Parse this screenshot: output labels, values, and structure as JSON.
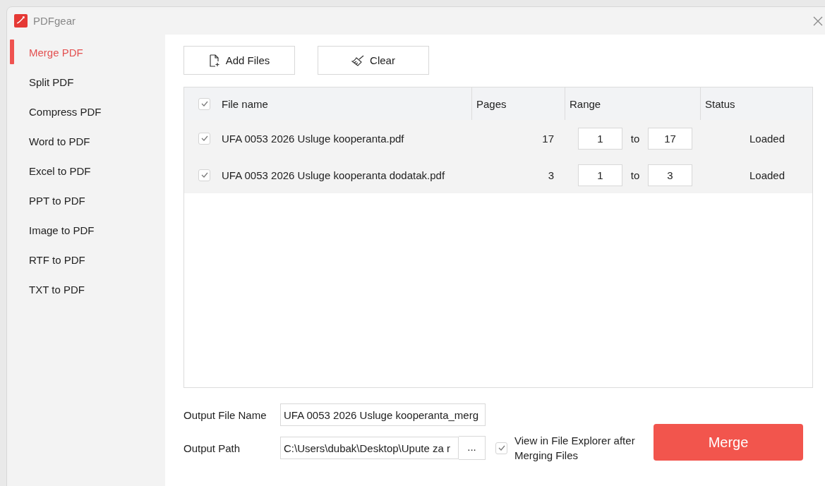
{
  "window": {
    "title": "PDFgear"
  },
  "sidebar": {
    "items": [
      {
        "label": "Merge PDF",
        "selected": true
      },
      {
        "label": "Split PDF",
        "selected": false
      },
      {
        "label": "Compress PDF",
        "selected": false
      },
      {
        "label": "Word to PDF",
        "selected": false
      },
      {
        "label": "Excel to PDF",
        "selected": false
      },
      {
        "label": "PPT to PDF",
        "selected": false
      },
      {
        "label": "Image to PDF",
        "selected": false
      },
      {
        "label": "RTF to PDF",
        "selected": false
      },
      {
        "label": "TXT to PDF",
        "selected": false
      }
    ]
  },
  "toolbar": {
    "buttons": [
      {
        "label": "Add Files",
        "kind": "add"
      },
      {
        "label": "Clear",
        "kind": "clear"
      }
    ]
  },
  "table": {
    "all_checked": true,
    "columns": [
      "File name",
      "Pages",
      "Range",
      "Status"
    ],
    "rows": [
      {
        "checked": true,
        "name": "UFA 0053 2026 Usluge kooperanta.pdf",
        "pages": "17",
        "from": "1",
        "separator": "to",
        "to": "17",
        "status": "Loaded"
      },
      {
        "checked": true,
        "name": "UFA 0053 2026 Usluge kooperanta dodatak.pdf",
        "pages": "3",
        "from": "1",
        "separator": "to",
        "to": "3",
        "status": "Loaded"
      }
    ]
  },
  "output": {
    "file_name_label": "Output File Name",
    "file_name": "UFA 0053 2026 Usluge kooperanta_merg",
    "path_label": "Output Path",
    "path": "C:\\Users\\dubak\\Desktop\\Upute za r",
    "browse": "...",
    "view_after": {
      "label": "View in File Explorer after Merging Files",
      "checked": true
    }
  },
  "merge_button": {
    "label": "Merge"
  }
}
